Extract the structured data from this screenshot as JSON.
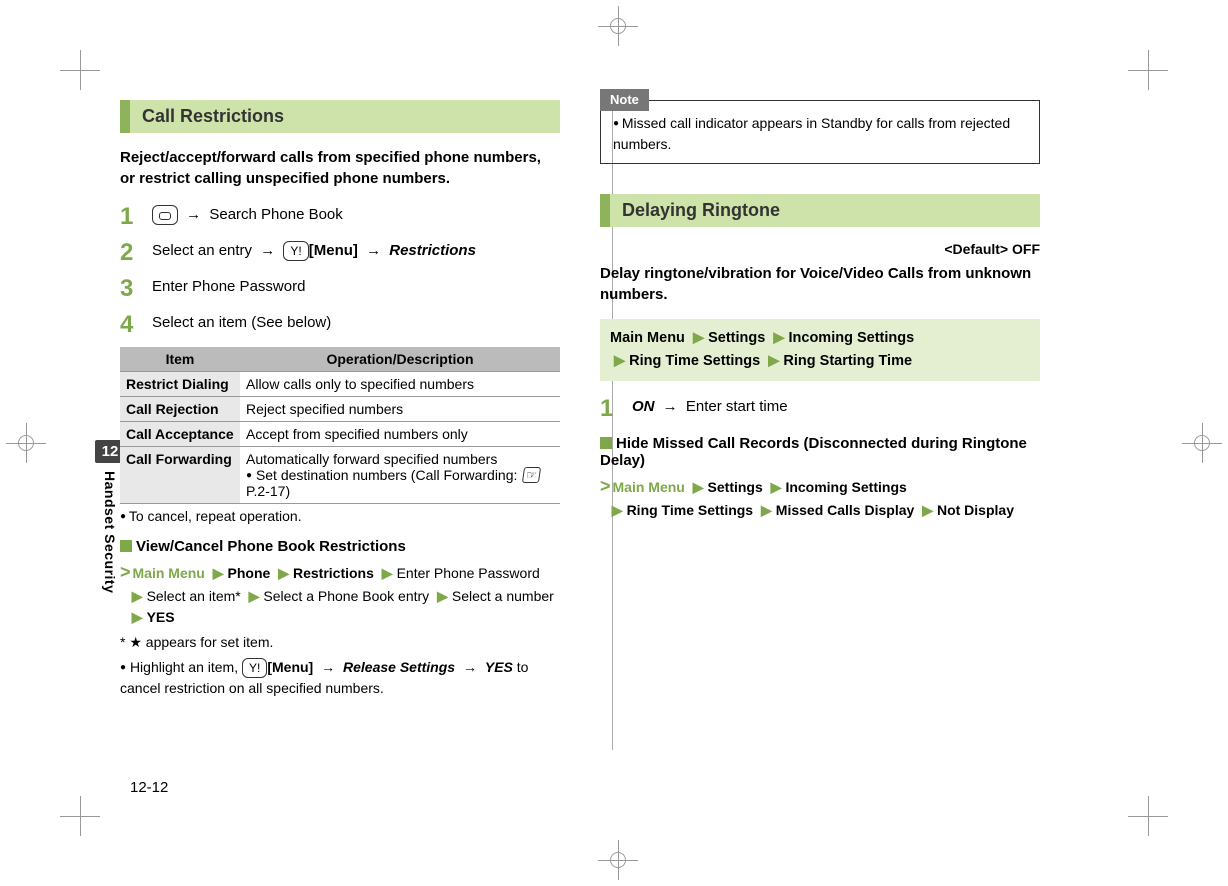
{
  "chapter": {
    "number": "12",
    "title": "Handset Security"
  },
  "page_number": "12-12",
  "left": {
    "section_title": "Call Restrictions",
    "lead": "Reject/accept/forward calls from specified phone numbers, or restrict calling unspecified phone numbers.",
    "steps": {
      "s1_text": "Search Phone Book",
      "s2_a": "Select an entry",
      "s2_menu": "[Menu]",
      "s2_c": "Restrictions",
      "s3": "Enter Phone Password",
      "s4": "Select an item (See below)"
    },
    "table": {
      "h1": "Item",
      "h2": "Operation/Description",
      "rows": [
        {
          "item": "Restrict Dialing",
          "desc": "Allow calls only to specified numbers",
          "extra": ""
        },
        {
          "item": "Call Rejection",
          "desc": "Reject specified numbers",
          "extra": ""
        },
        {
          "item": "Call Acceptance",
          "desc": "Accept from specified numbers only",
          "extra": ""
        },
        {
          "item": "Call Forwarding",
          "desc": "Automatically forward specified numbers",
          "extra": "Set destination numbers (Call Forwarding:",
          "extra_ref": "P.2-17)"
        }
      ]
    },
    "cancel_note": "To cancel, repeat operation.",
    "view_cancel": {
      "heading": "View/Cancel Phone Book Restrictions",
      "main_menu": "Main Menu",
      "phone": "Phone",
      "restrictions": "Restrictions",
      "enter_pw": "Enter Phone Password",
      "select_item": "Select an item*",
      "select_entry": "Select a Phone Book entry",
      "select_number": "Select a number",
      "yes": "YES",
      "star_note": "★ appears for set item.",
      "highlight_a": "Highlight an item,",
      "highlight_menu": "[Menu]",
      "highlight_rel": "Release Settings",
      "highlight_yes": "YES",
      "highlight_tail": "to cancel restriction on all specified numbers."
    }
  },
  "right": {
    "note_label": "Note",
    "note_body": "Missed call indicator appears in Standby for calls from rejected numbers.",
    "section_title": "Delaying Ringtone",
    "default_tag": "<Default> OFF",
    "lead": "Delay ringtone/vibration for Voice/Video Calls from unknown numbers.",
    "menu_path": {
      "main_menu": "Main Menu",
      "settings": "Settings",
      "incoming": "Incoming Settings",
      "ring_time": "Ring Time Settings",
      "ring_start": "Ring Starting Time"
    },
    "step1_on": "ON",
    "step1_tail": "Enter start time",
    "hide": {
      "heading": "Hide Missed Call Records (Disconnected during Ringtone Delay)",
      "main_menu": "Main Menu",
      "settings": "Settings",
      "incoming": "Incoming Settings",
      "ring_time": "Ring Time Settings",
      "missed": "Missed Calls Display",
      "not_display": "Not Display"
    }
  }
}
